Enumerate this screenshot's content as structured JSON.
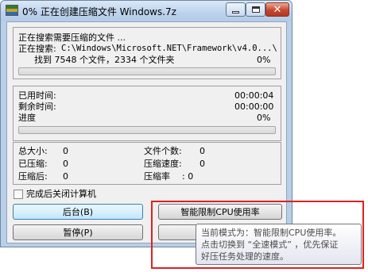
{
  "window": {
    "title": "0% 正在创建压缩文件 Windows.7z"
  },
  "search": {
    "heading": "正在搜索需要压缩的文件 ...",
    "path_label": "正在搜索:",
    "path_value": "C:\\Windows\\Microsoft.NET\\Framework\\v4.0...\\",
    "found_text": "找到 7548 个文件，2334 个文件夹",
    "percent": "0%",
    "progress_fraction": 0
  },
  "timing": {
    "elapsed_label": "已用时间:",
    "elapsed_value": "00:00:04",
    "remaining_label": "剩余时间:",
    "remaining_value": "00:00:00",
    "progress_label": "进度",
    "percent": "0%",
    "progress_fraction": 0
  },
  "stats": {
    "total_size_label": "总大小:",
    "total_size_value": "0",
    "compressed_label": "已压缩:",
    "compressed_value": "0",
    "after_label": "压缩后:",
    "after_value": "0",
    "file_count_label": "文件个数:",
    "file_count_value": "0",
    "speed_label": "压缩速度:",
    "speed_value": "0",
    "ratio_label": "压缩率",
    "ratio_value": ":   0"
  },
  "options": {
    "shutdown_label": "完成后关闭计算机",
    "shutdown_checked": false
  },
  "buttons": {
    "background": "后台(B)",
    "pause": "暂停(P)",
    "limit_cpu": "智能限制CPU使用率"
  },
  "tooltip": {
    "line1": "当前模式为：智能限制CPU使用率。",
    "line2": "点击切换到 “全速模式” ，优先保证",
    "line3": "好压任务处理的速度。"
  },
  "colors": {
    "highlight": "#e02020",
    "progress_fill": "#3cb043"
  }
}
